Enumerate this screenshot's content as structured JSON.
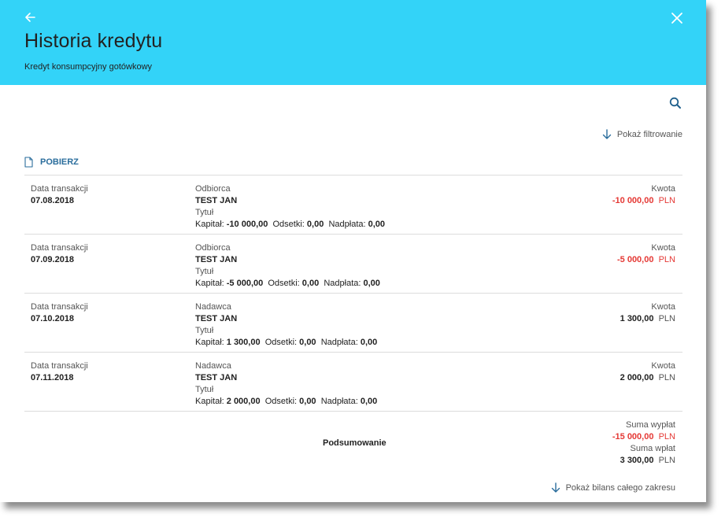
{
  "header": {
    "title": "Historia kredytu",
    "subtitle": "Kredyt konsumpcyjny gotówkowy",
    "background": "#33d3f8"
  },
  "toolbar": {
    "filter_label": "Pokaż filtrowanie",
    "download_label": "POBIERZ"
  },
  "rows": [
    {
      "date_label": "Data transakcji",
      "date": "07.08.2018",
      "party_label": "Odbiorca",
      "party": "TEST JAN",
      "title_label": "Tytuł",
      "capital_label": "Kapitał:",
      "capital": "-10 000,00",
      "interest_label": "Odsetki:",
      "interest": "0,00",
      "overpay_label": "Nadpłata:",
      "overpay": "0,00",
      "amount_label": "Kwota",
      "amount": "-10 000,00",
      "currency": "PLN",
      "negative": true
    },
    {
      "date_label": "Data transakcji",
      "date": "07.09.2018",
      "party_label": "Odbiorca",
      "party": "TEST JAN",
      "title_label": "Tytuł",
      "capital_label": "Kapitał:",
      "capital": "-5 000,00",
      "interest_label": "Odsetki:",
      "interest": "0,00",
      "overpay_label": "Nadpłata:",
      "overpay": "0,00",
      "amount_label": "Kwota",
      "amount": "-5 000,00",
      "currency": "PLN",
      "negative": true
    },
    {
      "date_label": "Data transakcji",
      "date": "07.10.2018",
      "party_label": "Nadawca",
      "party": "TEST JAN",
      "title_label": "Tytuł",
      "capital_label": "Kapitał:",
      "capital": "1 300,00",
      "interest_label": "Odsetki:",
      "interest": "0,00",
      "overpay_label": "Nadpłata:",
      "overpay": "0,00",
      "amount_label": "Kwota",
      "amount": "1 300,00",
      "currency": "PLN",
      "negative": false
    },
    {
      "date_label": "Data transakcji",
      "date": "07.11.2018",
      "party_label": "Nadawca",
      "party": "TEST JAN",
      "title_label": "Tytuł",
      "capital_label": "Kapitał:",
      "capital": "2 000,00",
      "interest_label": "Odsetki:",
      "interest": "0,00",
      "overpay_label": "Nadpłata:",
      "overpay": "0,00",
      "amount_label": "Kwota",
      "amount": "2 000,00",
      "currency": "PLN",
      "negative": false
    }
  ],
  "summary": {
    "label": "Podsumowanie",
    "withdrawals_label": "Suma wypłat",
    "withdrawals": "-15 000,00",
    "deposits_label": "Suma wpłat",
    "deposits": "3 300,00",
    "currency": "PLN"
  },
  "footer": {
    "balance_link": "Pokaż bilans całego zakresu"
  },
  "colors": {
    "accent": "#2a6d9c",
    "negative": "#e53935",
    "icon": "#1e5f8c"
  },
  "icons": {
    "back": "arrow-left-icon",
    "close": "close-icon",
    "search": "search-icon",
    "filter": "arrow-down-icon",
    "download": "document-icon"
  }
}
